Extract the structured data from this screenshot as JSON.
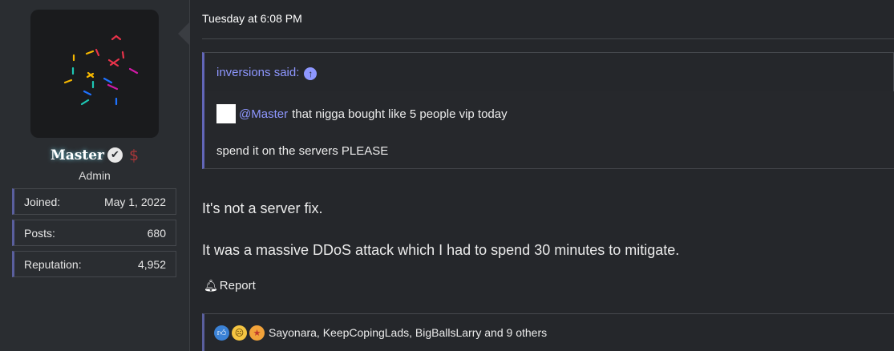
{
  "user": {
    "name": "Master",
    "role": "Admin",
    "stats": [
      {
        "label": "Joined:",
        "value": "May 1, 2022"
      },
      {
        "label": "Posts:",
        "value": "680"
      },
      {
        "label": "Reputation:",
        "value": "4,952"
      }
    ]
  },
  "post": {
    "timestamp": "Tuesday at 6:08 PM",
    "quote": {
      "author": "inversions said:",
      "mention": "@Master",
      "line1_rest": "that nigga bought like 5 people vip today",
      "line2": "spend it on the servers PLEASE"
    },
    "message": [
      "It's not a server fix.",
      "It was a massive DDoS attack which I had to spend 30 minutes to mitigate."
    ],
    "report_label": "Report",
    "reactions_text": "Sayonara, KeepCopingLads, BigBallsLarry and 9 others"
  },
  "icons": [
    "verified-icon",
    "dollar-icon",
    "up-arrow-icon",
    "bell-icon",
    "like-icon",
    "cry-icon",
    "star-eyes-icon"
  ],
  "colors": {
    "accent": "#8e97ff",
    "background": "#25272b",
    "sidebar": "#2a2d31"
  }
}
